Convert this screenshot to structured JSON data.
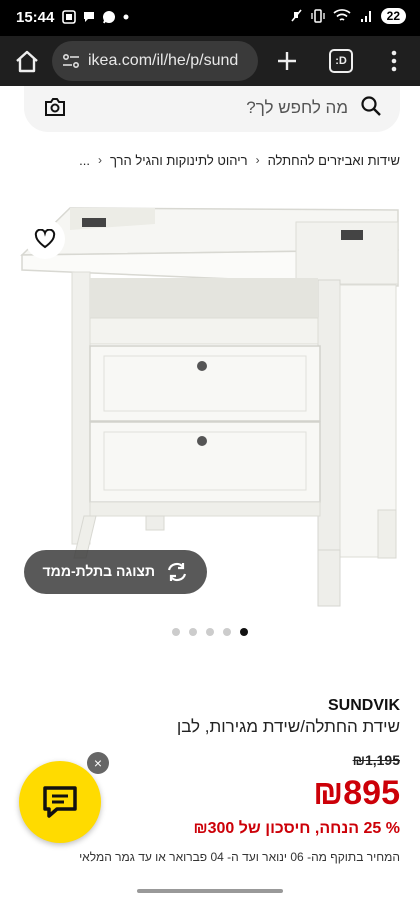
{
  "status_bar": {
    "time": "15:44",
    "battery": "22",
    "left_icons": [
      "screenshot-icon",
      "chat-bubble-icon",
      "whatsapp-icon",
      "dot-icon"
    ],
    "right_icons": [
      "mute-icon",
      "vibrate-icon",
      "wifi-icon",
      "signal-icon"
    ]
  },
  "browser": {
    "url": "ikea.com/il/he/p/sund",
    "tabs_label": ":D"
  },
  "search": {
    "placeholder": "מה לחפש לך?"
  },
  "breadcrumb": {
    "items": [
      "ריהוט לתינוקות והגיל הרך",
      "שידות ואביזרים להחתלה"
    ],
    "overflow": "..."
  },
  "product": {
    "view3d_label": "תצוגה בתלת-ממד",
    "image_dots": {
      "count": 5,
      "active_index": 4
    },
    "name": "SUNDVIK",
    "description": "שידת החתלה/שידת מגירות, לבן",
    "old_price": "₪1,195",
    "new_price": "₪895",
    "savings": "% 25 הנחה, חיסכון של ₪300",
    "validity": "המחיר בתוקף מה- 06 ינואר ועד ה- 04 פברואר או עד גמר המלאי"
  },
  "chat": {
    "close_label": "×"
  },
  "colors": {
    "price_red": "#cc0008",
    "chat_yellow": "#ffdb00",
    "browser_dark": "#1f1f1f"
  }
}
